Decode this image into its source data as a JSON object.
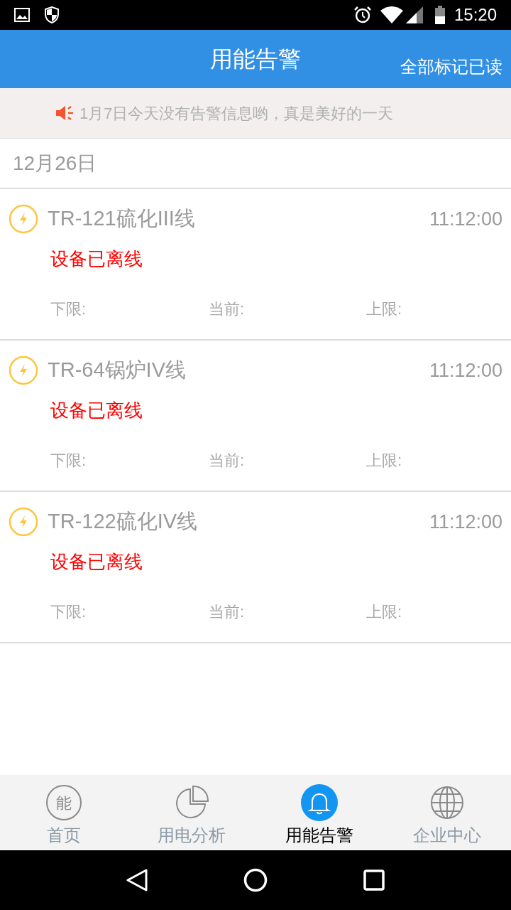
{
  "status_bar": {
    "time": "15:20"
  },
  "header": {
    "title": "用能告警",
    "action": "全部标记已读"
  },
  "notice": {
    "text": "1月7日今天没有告警信息哟，真是美好的一天"
  },
  "date_heading": "12月26日",
  "alerts": [
    {
      "name": "TR-121硫化III线",
      "time": "11:12:00",
      "status": "设备已离线",
      "lower_label": "下限:",
      "current_label": "当前:",
      "upper_label": "上限:"
    },
    {
      "name": "TR-64锅炉IV线",
      "time": "11:12:00",
      "status": "设备已离线",
      "lower_label": "下限:",
      "current_label": "当前:",
      "upper_label": "上限:"
    },
    {
      "name": "TR-122硫化IV线",
      "time": "11:12:00",
      "status": "设备已离线",
      "lower_label": "下限:",
      "current_label": "当前:",
      "upper_label": "上限:"
    }
  ],
  "tabs": [
    {
      "kind": "home",
      "icon_text": "能",
      "label": "首页",
      "selected": false
    },
    {
      "kind": "analysis",
      "label": "用电分析",
      "selected": false
    },
    {
      "kind": "alerts",
      "label": "用能告警",
      "selected": true
    },
    {
      "kind": "company",
      "label": "企业中心",
      "selected": false
    }
  ]
}
